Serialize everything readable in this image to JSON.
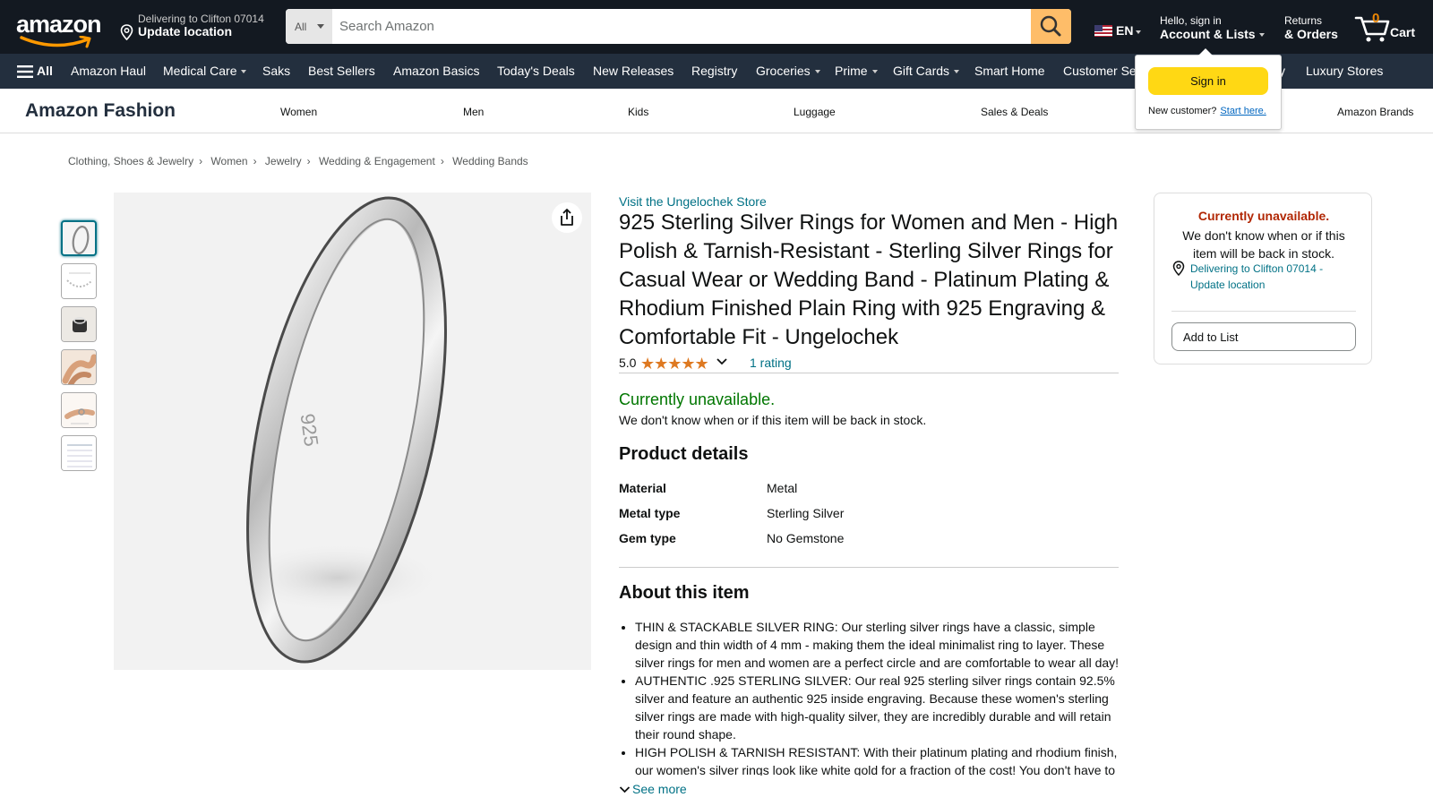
{
  "header": {
    "logo_text": "amazon",
    "deliver_line1": "Delivering to Clifton 07014",
    "deliver_line2": "Update location",
    "search": {
      "category": "All",
      "placeholder": "Search Amazon"
    },
    "language": "EN",
    "account_line1": "Hello, sign in",
    "account_line2": "Account & Lists",
    "returns_line1": "Returns",
    "returns_line2": "& Orders",
    "cart_count": "0",
    "cart_label": "Cart"
  },
  "subnav": {
    "all_label": "All",
    "items": [
      {
        "label": "Amazon Haul",
        "dropdown": false
      },
      {
        "label": "Medical Care",
        "dropdown": true
      },
      {
        "label": "Saks",
        "dropdown": false
      },
      {
        "label": "Best Sellers",
        "dropdown": false
      },
      {
        "label": "Amazon Basics",
        "dropdown": false
      },
      {
        "label": "Today's Deals",
        "dropdown": false
      },
      {
        "label": "New Releases",
        "dropdown": false
      },
      {
        "label": "Registry",
        "dropdown": false
      },
      {
        "label": "Groceries",
        "dropdown": true
      },
      {
        "label": "Prime",
        "dropdown": true
      },
      {
        "label": "Gift Cards",
        "dropdown": true
      },
      {
        "label": "Smart Home",
        "dropdown": false
      },
      {
        "label": "Customer Se",
        "dropdown": false
      },
      {
        "label": "y",
        "dropdown": false
      },
      {
        "label": "Luxury Stores",
        "dropdown": false
      }
    ]
  },
  "fashion_bar": {
    "brand": "Amazon Fashion",
    "links": [
      "Women",
      "Men",
      "Kids",
      "Luggage",
      "Sales & Deals",
      "Amazon Brands"
    ]
  },
  "signin_flyout": {
    "button": "Sign in",
    "new_customer": "New customer?",
    "start_here": "Start here."
  },
  "breadcrumb": [
    "Clothing, Shoes & Jewelry",
    "Women",
    "Jewelry",
    "Wedding & Engagement",
    "Wedding Bands"
  ],
  "product": {
    "store_link": "Visit the Ungelochek Store",
    "title": "925 Sterling Silver Rings for Women and Men - High Polish & Tarnish-Resistant - Sterling Silver Rings for Casual Wear or Wedding Band - Platinum Plating & Rhodium Finished Plain Ring with 925 Engraving & Comfortable Fit - Ungelochek",
    "rating_value": "5.0",
    "stars": 5,
    "rating_count": "1 rating",
    "availability": "Currently unavailable.",
    "availability_note": "We don't know when or if this item will be back in stock.",
    "ring_engraving": "925",
    "details_title": "Product details",
    "details": [
      {
        "key": "Material",
        "value": "Metal"
      },
      {
        "key": "Metal type",
        "value": "Sterling Silver"
      },
      {
        "key": "Gem type",
        "value": "No Gemstone"
      }
    ],
    "about_title": "About this item",
    "bullets": [
      "THIN & STACKABLE SILVER RING: Our sterling silver rings have a classic, simple design and thin width of 4 mm - making them the ideal minimalist ring to layer. These silver rings for men and women are a perfect circle and are comfortable to wear all day!",
      "AUTHENTIC .925 STERLING SILVER: Our real 925 sterling silver rings contain 92.5% silver and feature an authentic 925 inside engraving. Because these women's sterling silver rings are made with high-quality silver, they are incredibly durable and will retain their round shape.",
      "HIGH POLISH & TARNISH RESISTANT: With their platinum plating and rhodium finish, our women's silver rings look like white gold for a fraction of the cost! You don't have to"
    ],
    "see_more": "See more"
  },
  "buybox": {
    "status": "Currently unavailable.",
    "note": "We don't know when or if this item will be back in stock.",
    "location": "Delivering to Clifton 07014 - Update location",
    "add_to_list": "Add to List"
  },
  "colors": {
    "nav_dark": "#131921",
    "nav_secondary": "#232f3e",
    "search_button": "#febd69",
    "signin_button": "#ffd814",
    "link": "#007185",
    "in_stock_green": "#007600",
    "unavailable_red": "#b12704",
    "star": "#de7921"
  }
}
